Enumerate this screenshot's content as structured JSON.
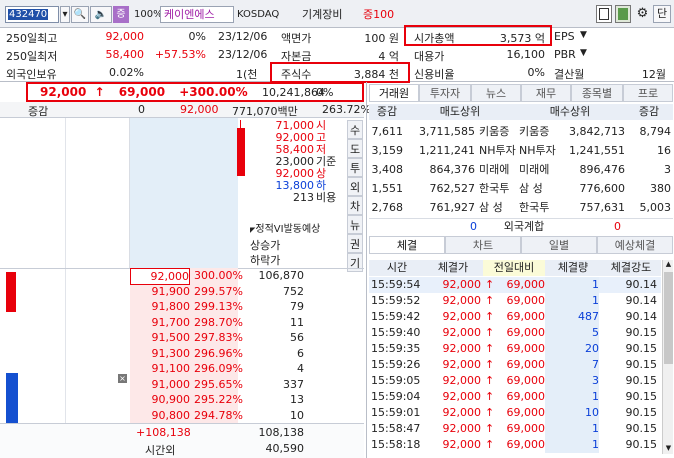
{
  "toolbar": {
    "code": "432470",
    "search": "🔍",
    "sound": "🔈",
    "icon_fund": "증",
    "pct100": "100%",
    "name": "케이엔에스",
    "market": "KOSDAQ",
    "sector": "기계장비",
    "margin": "증100",
    "unit_btn": "단"
  },
  "info": {
    "rows": [
      [
        "250일최고",
        "92,000",
        "0%",
        "23/12/06",
        "액면가",
        "100 원",
        "시가총액",
        "3,573 억",
        "EPS"
      ],
      [
        "250일최저",
        "58,400",
        "+57.53%",
        "23/12/06",
        "자본금",
        "4 억",
        "대용가",
        "16,100",
        "PBR"
      ],
      [
        "외국인보유",
        "0.02%",
        "",
        "1(천",
        "주식수",
        "3,884 천",
        "신용비율",
        "0%",
        "결산월"
      ]
    ],
    "settle_month": "12월"
  },
  "price": {
    "current": "92,000",
    "arrow": "↑",
    "change": "69,000",
    "rate": "+300.00%",
    "volume": "10,241,864",
    "vol_rate": "0%"
  },
  "price2": {
    "label": "증감",
    "zero": "0",
    "price": "92,000",
    "amount": "771,070백만",
    "pct": "263.72%"
  },
  "summary": [
    {
      "label": "시",
      "value": "71,000",
      "cls": "red"
    },
    {
      "label": "고",
      "value": "92,000",
      "cls": "red"
    },
    {
      "label": "저",
      "value": "58,400",
      "cls": "red"
    },
    {
      "label": "기준",
      "value": "23,000",
      "cls": ""
    },
    {
      "label": "상",
      "value": "92,000",
      "cls": "red"
    },
    {
      "label": "하",
      "value": "13,800",
      "cls": "blue"
    },
    {
      "label": "비용",
      "value": "213",
      "cls": ""
    }
  ],
  "vi": [
    "정적VI발동예상",
    "상승가",
    "하락가"
  ],
  "vtabs": [
    "수",
    "도",
    "투",
    "외",
    "차",
    "뉴",
    "권",
    "기"
  ],
  "orders": [
    {
      "price": "92,000",
      "pct": "300.00%",
      "qty": "106,870",
      "bar": 100
    },
    {
      "price": "91,900",
      "pct": "299.57%",
      "qty": "752",
      "bar": 4
    },
    {
      "price": "91,800",
      "pct": "299.13%",
      "qty": "79",
      "bar": 0
    },
    {
      "price": "91,700",
      "pct": "298.70%",
      "qty": "11",
      "bar": 0
    },
    {
      "price": "91,500",
      "pct": "297.83%",
      "qty": "56",
      "bar": 0
    },
    {
      "price": "91,300",
      "pct": "296.96%",
      "qty": "6",
      "bar": 0
    },
    {
      "price": "91,100",
      "pct": "296.09%",
      "qty": "4",
      "bar": 0
    },
    {
      "price": "91,000",
      "pct": "295.65%",
      "qty": "337",
      "bar": 0
    },
    {
      "price": "90,900",
      "pct": "295.22%",
      "qty": "13",
      "bar": 0
    },
    {
      "price": "90,800",
      "pct": "294.78%",
      "qty": "10",
      "bar": 0
    }
  ],
  "bottom": {
    "diff": "+108,138",
    "total": "108,138",
    "label": "시간외",
    "after": "40,590"
  },
  "broker_tabs": [
    "거래원",
    "투자자",
    "뉴스",
    "재무",
    "종목별",
    "프로"
  ],
  "broker": {
    "head": [
      "증감",
      "매도상위",
      "매수상위",
      "증감"
    ],
    "rows": [
      [
        "7,611",
        "3,711,585",
        "키움증",
        "키움증",
        "3,842,713",
        "8,794"
      ],
      [
        "3,159",
        "1,211,241",
        "NH투자",
        "NH투자",
        "1,241,551",
        "16"
      ],
      [
        "3,408",
        "864,376",
        "미래에",
        "미래에",
        "896,476",
        "3"
      ],
      [
        "1,551",
        "762,527",
        "한국투",
        "삼 성",
        "776,600",
        "380"
      ],
      [
        "2,768",
        "761,927",
        "삼 성",
        "한국투",
        "757,631",
        "5,003"
      ]
    ],
    "foreign": [
      "0",
      "외국계합",
      "0"
    ]
  },
  "trade_tabs": [
    "체결",
    "차트",
    "일별",
    "예상체결"
  ],
  "trades": {
    "head": [
      "시간",
      "체결가",
      "전일대비",
      "체결량",
      "체결강도"
    ],
    "rows": [
      [
        "15:59:54",
        "92,000",
        "69,000",
        "1",
        "90.14"
      ],
      [
        "15:59:52",
        "92,000",
        "69,000",
        "1",
        "90.14"
      ],
      [
        "15:59:42",
        "92,000",
        "69,000",
        "487",
        "90.14"
      ],
      [
        "15:59:40",
        "92,000",
        "69,000",
        "5",
        "90.15"
      ],
      [
        "15:59:35",
        "92,000",
        "69,000",
        "20",
        "90.15"
      ],
      [
        "15:59:26",
        "92,000",
        "69,000",
        "7",
        "90.15"
      ],
      [
        "15:59:05",
        "92,000",
        "69,000",
        "3",
        "90.15"
      ],
      [
        "15:59:04",
        "92,000",
        "69,000",
        "1",
        "90.15"
      ],
      [
        "15:59:01",
        "92,000",
        "69,000",
        "10",
        "90.15"
      ],
      [
        "15:58:47",
        "92,000",
        "69,000",
        "1",
        "90.15"
      ],
      [
        "15:58:18",
        "92,000",
        "69,000",
        "1",
        "90.15"
      ]
    ]
  },
  "colors": {
    "up": "#e8000b",
    "down": "#0a3fd8",
    "highlight": "#e8000b"
  }
}
